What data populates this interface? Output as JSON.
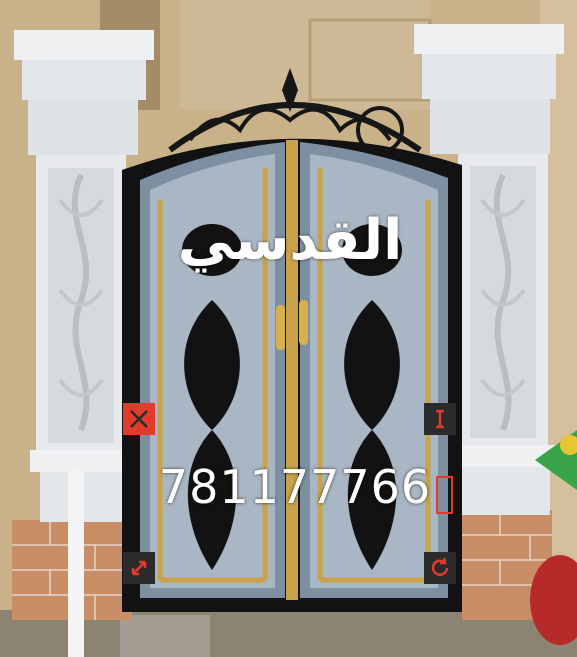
{
  "overlay": {
    "title": "القدسي",
    "phone": "781177766"
  },
  "icons": {
    "close": "close-icon",
    "resize": "text-cursor-icon",
    "scale": "diagonal-resize-icon",
    "rotate": "rotate-icon"
  },
  "colors": {
    "handle_accent": "#e23b2e",
    "handle_dark": "#2b2b2b",
    "text": "#ffffff",
    "gate_black": "#111111",
    "gate_gold": "#c9a24a",
    "pillar_white": "#e9ecef",
    "wall_tan": "#cbb58e",
    "brick": "#c9906a"
  }
}
